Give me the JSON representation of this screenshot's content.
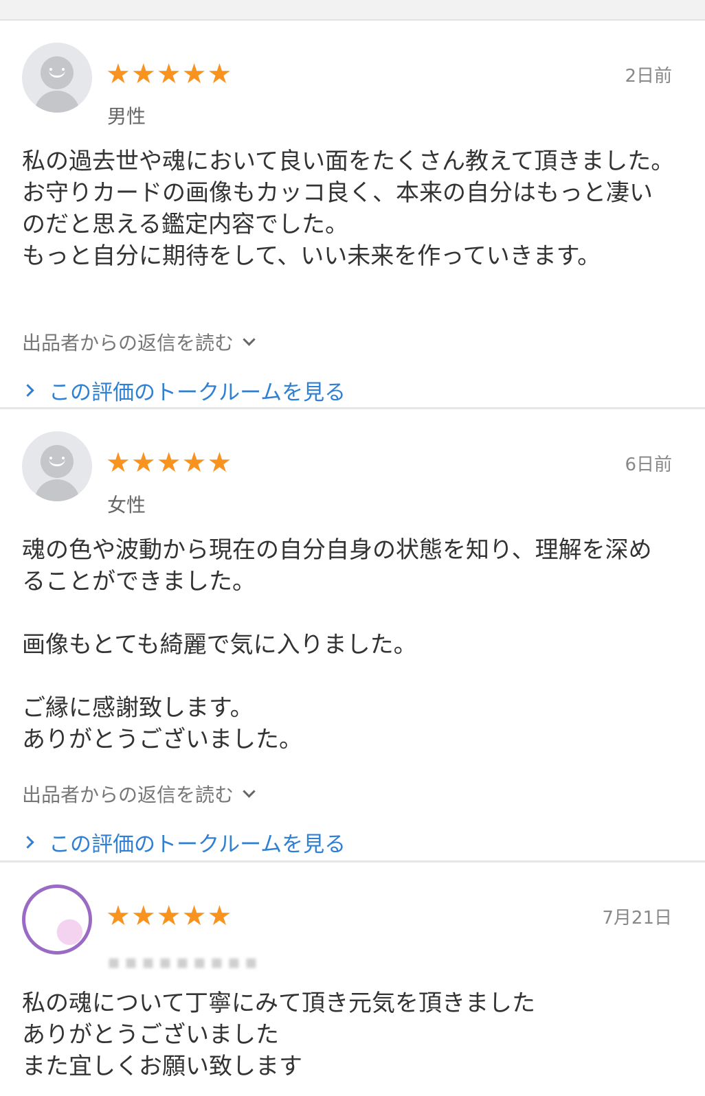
{
  "reviews": [
    {
      "stars": 5,
      "gender": "男性",
      "date": "2日前",
      "text": "私の過去世や魂において良い面をたくさん教えて頂きました。\nお守りカードの画像もカッコ良く、本来の自分はもっと凄いのだと思える鑑定内容でした。\nもっと自分に期待をして、いい未来を作っていきます。",
      "reply_label": "出品者からの返信を読む",
      "talk_label": "この評価のトークルームを見る"
    },
    {
      "stars": 5,
      "gender": "女性",
      "date": "6日前",
      "text": "魂の色や波動から現在の自分自身の状態を知り、理解を深めることができました。\n\n画像もとても綺麗で気に入りました。\n\nご縁に感謝致します。\nありがとうございました。",
      "reply_label": "出品者からの返信を読む",
      "talk_label": "この評価のトークルームを見る"
    },
    {
      "stars": 5,
      "date": "7月21日",
      "text": "私の魂について丁寧にみて頂き元気を頂きました\nありがとうございました\nまた宜しくお願い致します"
    }
  ],
  "colors": {
    "star": "#f7931e",
    "link": "#2f7fd3",
    "body_text": "#333333",
    "muted_text": "#777777"
  },
  "icons": {
    "star": "★",
    "reply_toggle": "chevron-down-icon",
    "talk_link": "chevron-right-icon"
  }
}
